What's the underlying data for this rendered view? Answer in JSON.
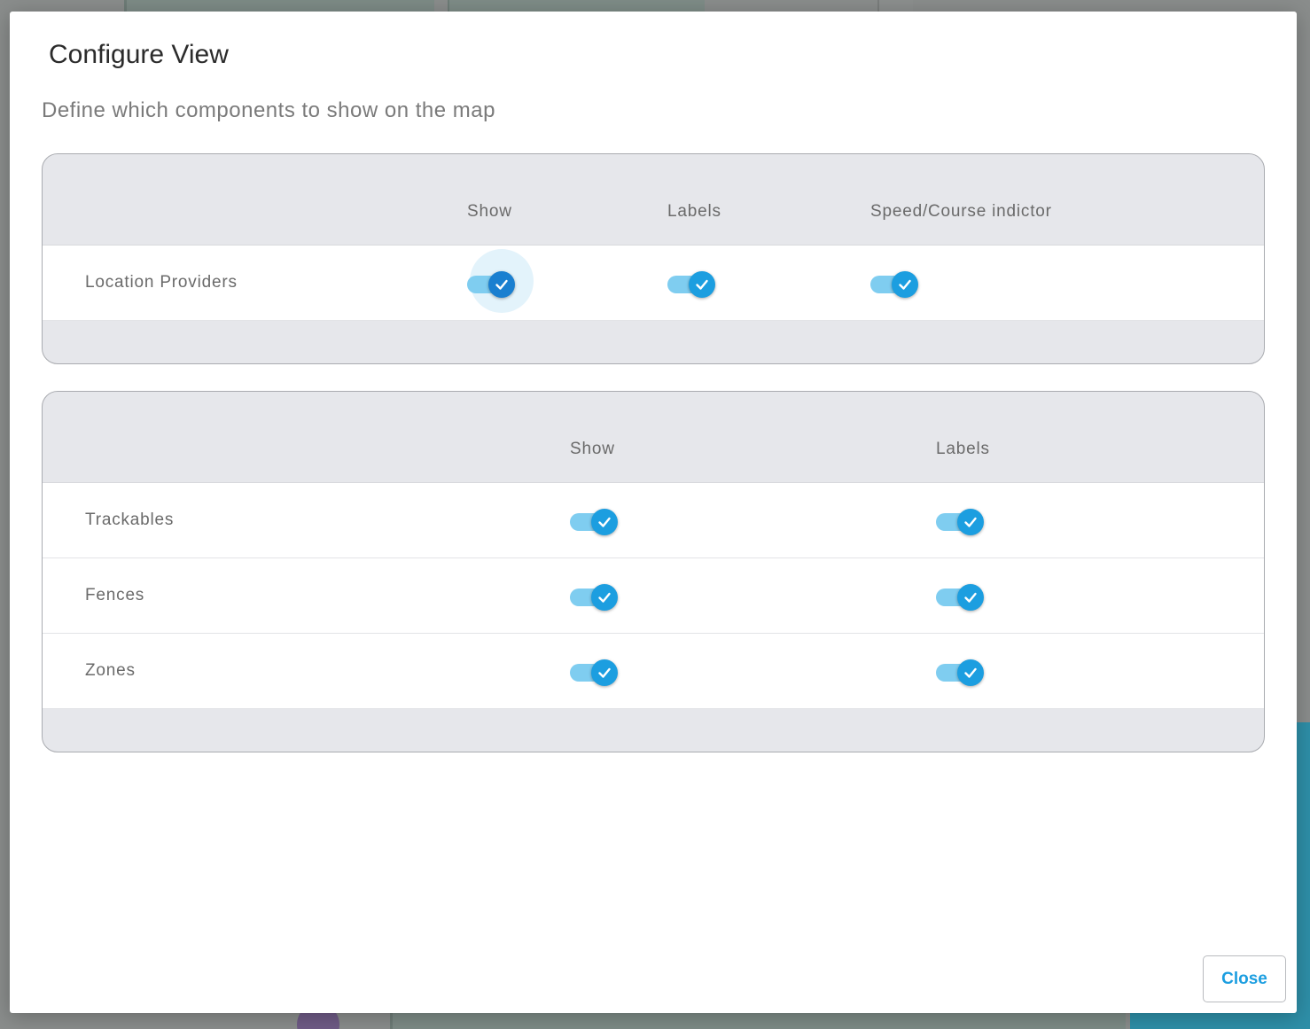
{
  "dialog": {
    "title": "Configure View",
    "subtitle": "Define which components to show on the map",
    "close_label": "Close"
  },
  "providers_panel": {
    "columns": [
      "Show",
      "Labels",
      "Speed/Course indictor"
    ],
    "rows": [
      {
        "label": "Location Providers",
        "show": true,
        "labels": true,
        "speed_course": true
      }
    ]
  },
  "layers_panel": {
    "columns": [
      "Show",
      "Labels"
    ],
    "rows": [
      {
        "label": "Trackables",
        "show": true,
        "labels": true
      },
      {
        "label": "Fences",
        "show": true,
        "labels": true
      },
      {
        "label": "Zones",
        "show": true,
        "labels": true
      }
    ]
  },
  "colors": {
    "accent": "#1c9ee0",
    "track": "#7fcdf0",
    "panel_bg": "#e6e7eb"
  },
  "icons": {
    "toggle_knob": "check-icon"
  }
}
